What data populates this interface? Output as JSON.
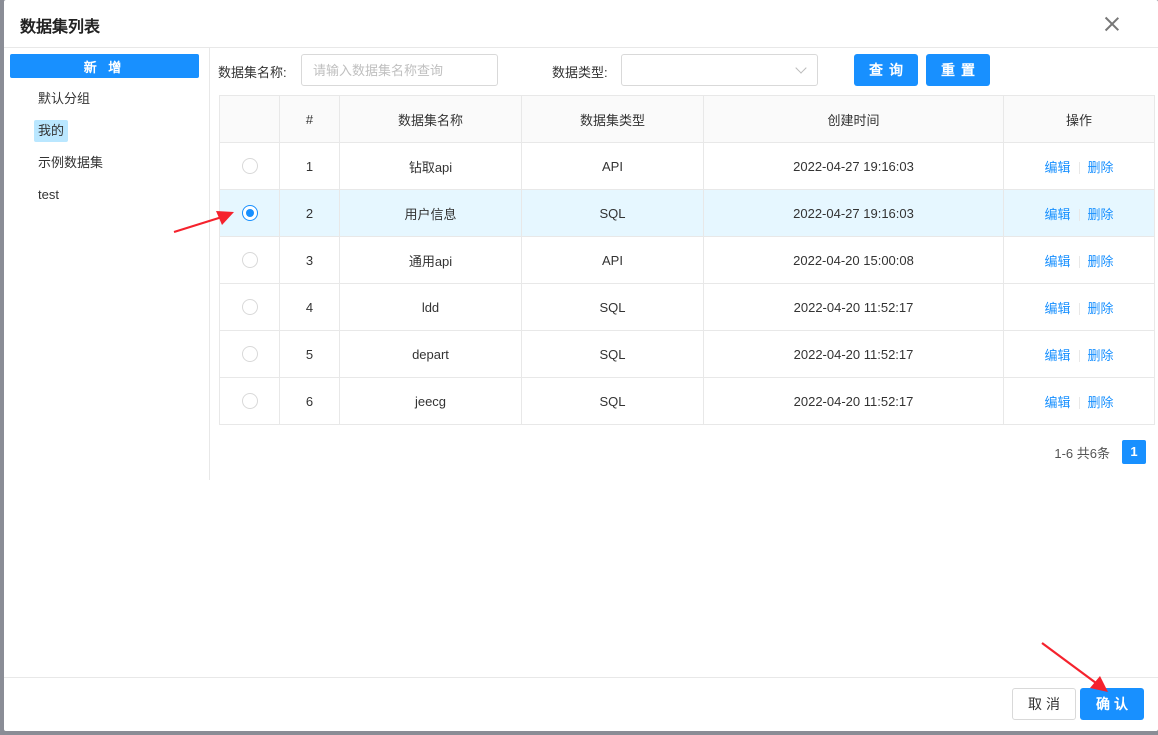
{
  "modal": {
    "title": "数据集列表"
  },
  "sidebar": {
    "add_label": "新 增",
    "tree": [
      "默认分组",
      "我的",
      "示例数据集",
      "test"
    ],
    "selected": "我的"
  },
  "search": {
    "name_label": "数据集名称:",
    "name_placeholder": "请输入数据集名称查询",
    "type_label": "数据类型:",
    "query_label": "查询",
    "reset_label": "重置"
  },
  "table": {
    "columns": [
      "#",
      "数据集名称",
      "数据集类型",
      "创建时间",
      "操作"
    ],
    "rows": [
      {
        "index": "1",
        "name": "钻取api",
        "type": "API",
        "created": "2022-04-27 19:16:03",
        "selected": false
      },
      {
        "index": "2",
        "name": "用户信息",
        "type": "SQL",
        "created": "2022-04-27 19:16:03",
        "selected": true
      },
      {
        "index": "3",
        "name": "通用api",
        "type": "API",
        "created": "2022-04-20 15:00:08",
        "selected": false
      },
      {
        "index": "4",
        "name": "ldd",
        "type": "SQL",
        "created": "2022-04-20 11:52:17",
        "selected": false
      },
      {
        "index": "5",
        "name": "depart",
        "type": "SQL",
        "created": "2022-04-20 11:52:17",
        "selected": false
      },
      {
        "index": "6",
        "name": "jeecg",
        "type": "SQL",
        "created": "2022-04-20 11:52:17",
        "selected": false
      }
    ],
    "edit_label": "编辑",
    "delete_label": "删除"
  },
  "pagination": {
    "total_text": "1-6 共6条",
    "current_page": "1"
  },
  "footer": {
    "cancel_label": "取消",
    "ok_label": "确认"
  },
  "colors": {
    "primary": "#1890ff",
    "selected_row": "#e6f7ff",
    "annotation_arrow": "#f5222d"
  }
}
